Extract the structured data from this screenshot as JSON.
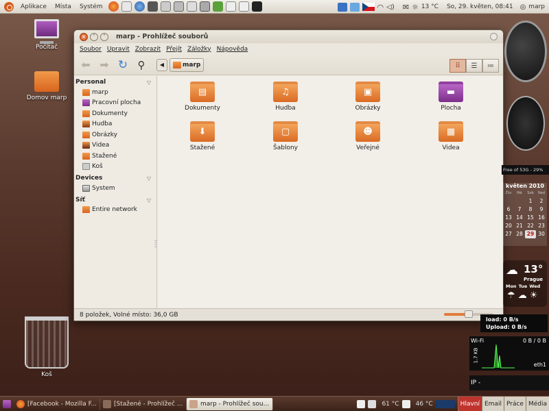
{
  "top_panel": {
    "menus": [
      "Aplikace",
      "Místa",
      "Systém"
    ],
    "weather": "13 °C",
    "datetime": "So, 29. květen, 08:41",
    "user": "marp"
  },
  "desktop": {
    "icons": [
      {
        "label": "Počítač"
      },
      {
        "label": "Domov marp"
      },
      {
        "label": "Koš"
      }
    ]
  },
  "window": {
    "title": "marp - Prohlížeč souborů",
    "menus": [
      "Soubor",
      "Upravit",
      "Zobrazit",
      "Přejít",
      "Záložky",
      "Nápověda"
    ],
    "path": "marp",
    "sidebar": {
      "sections": [
        {
          "title": "Personal",
          "items": [
            "marp",
            "Pracovní plocha",
            "Dokumenty",
            "Hudba",
            "Obrázky",
            "Videa",
            "Stažené",
            "Koš"
          ]
        },
        {
          "title": "Devices",
          "items": [
            "System"
          ]
        },
        {
          "title": "Síť",
          "items": [
            "Entire network"
          ]
        }
      ]
    },
    "files": [
      {
        "label": "Dokumenty",
        "icon": "documents-folder-icon"
      },
      {
        "label": "Hudba",
        "icon": "music-folder-icon"
      },
      {
        "label": "Obrázky",
        "icon": "pictures-folder-icon"
      },
      {
        "label": "Plocha",
        "icon": "desktop-folder-icon"
      },
      {
        "label": "Stažené",
        "icon": "downloads-folder-icon"
      },
      {
        "label": "Šablony",
        "icon": "templates-folder-icon"
      },
      {
        "label": "Veřejné",
        "icon": "public-folder-icon"
      },
      {
        "label": "Videa",
        "icon": "videos-folder-icon"
      }
    ],
    "status": "8 položek, Volné místo: 36,0 GB",
    "zoom_fraction": 0.5
  },
  "widgets": {
    "disk": "Free of 53G - 29%",
    "calendar": {
      "month": "květen 2010",
      "day_headers": [
        "Čtv",
        "Pát",
        "Sob",
        "Ned"
      ],
      "rows": [
        [
          "",
          "",
          "1",
          "2"
        ],
        [
          "6",
          "7",
          "8",
          "9"
        ],
        [
          "13",
          "14",
          "15",
          "16"
        ],
        [
          "20",
          "21",
          "22",
          "23"
        ],
        [
          "27",
          "28",
          "29",
          "30"
        ]
      ],
      "today": "29"
    },
    "weather": {
      "temp": "13°",
      "city": "Prague",
      "days": [
        "Mon",
        "Tue",
        "Wed"
      ]
    },
    "net": {
      "download": "load: 0 B/s",
      "upload": "Upload: 0 B/s"
    },
    "wifi": {
      "label": "Wi-Fi",
      "rate": "0 B / 0 B",
      "total": "1.7 KB",
      "iface": "eth1"
    },
    "ip_label": "IP -"
  },
  "bottom_panel": {
    "tasks": [
      "[Facebook - Mozilla F...",
      "[Stažené - Prohlížeč ...",
      "marp - Prohlížeč sou..."
    ],
    "temp1": "61 °C",
    "temp2": "46 °C",
    "workspaces": [
      "Hlavní",
      "Email",
      "Práce",
      "Média"
    ]
  }
}
